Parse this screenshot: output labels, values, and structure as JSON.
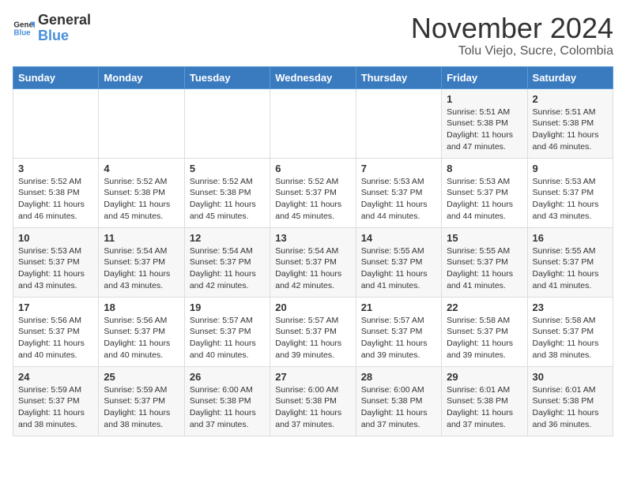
{
  "header": {
    "logo_general": "General",
    "logo_blue": "Blue",
    "month_year": "November 2024",
    "location": "Tolu Viejo, Sucre, Colombia"
  },
  "weekdays": [
    "Sunday",
    "Monday",
    "Tuesday",
    "Wednesday",
    "Thursday",
    "Friday",
    "Saturday"
  ],
  "weeks": [
    [
      {
        "day": "",
        "info": ""
      },
      {
        "day": "",
        "info": ""
      },
      {
        "day": "",
        "info": ""
      },
      {
        "day": "",
        "info": ""
      },
      {
        "day": "",
        "info": ""
      },
      {
        "day": "1",
        "info": "Sunrise: 5:51 AM\nSunset: 5:38 PM\nDaylight: 11 hours\nand 47 minutes."
      },
      {
        "day": "2",
        "info": "Sunrise: 5:51 AM\nSunset: 5:38 PM\nDaylight: 11 hours\nand 46 minutes."
      }
    ],
    [
      {
        "day": "3",
        "info": "Sunrise: 5:52 AM\nSunset: 5:38 PM\nDaylight: 11 hours\nand 46 minutes."
      },
      {
        "day": "4",
        "info": "Sunrise: 5:52 AM\nSunset: 5:38 PM\nDaylight: 11 hours\nand 45 minutes."
      },
      {
        "day": "5",
        "info": "Sunrise: 5:52 AM\nSunset: 5:38 PM\nDaylight: 11 hours\nand 45 minutes."
      },
      {
        "day": "6",
        "info": "Sunrise: 5:52 AM\nSunset: 5:37 PM\nDaylight: 11 hours\nand 45 minutes."
      },
      {
        "day": "7",
        "info": "Sunrise: 5:53 AM\nSunset: 5:37 PM\nDaylight: 11 hours\nand 44 minutes."
      },
      {
        "day": "8",
        "info": "Sunrise: 5:53 AM\nSunset: 5:37 PM\nDaylight: 11 hours\nand 44 minutes."
      },
      {
        "day": "9",
        "info": "Sunrise: 5:53 AM\nSunset: 5:37 PM\nDaylight: 11 hours\nand 43 minutes."
      }
    ],
    [
      {
        "day": "10",
        "info": "Sunrise: 5:53 AM\nSunset: 5:37 PM\nDaylight: 11 hours\nand 43 minutes."
      },
      {
        "day": "11",
        "info": "Sunrise: 5:54 AM\nSunset: 5:37 PM\nDaylight: 11 hours\nand 43 minutes."
      },
      {
        "day": "12",
        "info": "Sunrise: 5:54 AM\nSunset: 5:37 PM\nDaylight: 11 hours\nand 42 minutes."
      },
      {
        "day": "13",
        "info": "Sunrise: 5:54 AM\nSunset: 5:37 PM\nDaylight: 11 hours\nand 42 minutes."
      },
      {
        "day": "14",
        "info": "Sunrise: 5:55 AM\nSunset: 5:37 PM\nDaylight: 11 hours\nand 41 minutes."
      },
      {
        "day": "15",
        "info": "Sunrise: 5:55 AM\nSunset: 5:37 PM\nDaylight: 11 hours\nand 41 minutes."
      },
      {
        "day": "16",
        "info": "Sunrise: 5:55 AM\nSunset: 5:37 PM\nDaylight: 11 hours\nand 41 minutes."
      }
    ],
    [
      {
        "day": "17",
        "info": "Sunrise: 5:56 AM\nSunset: 5:37 PM\nDaylight: 11 hours\nand 40 minutes."
      },
      {
        "day": "18",
        "info": "Sunrise: 5:56 AM\nSunset: 5:37 PM\nDaylight: 11 hours\nand 40 minutes."
      },
      {
        "day": "19",
        "info": "Sunrise: 5:57 AM\nSunset: 5:37 PM\nDaylight: 11 hours\nand 40 minutes."
      },
      {
        "day": "20",
        "info": "Sunrise: 5:57 AM\nSunset: 5:37 PM\nDaylight: 11 hours\nand 39 minutes."
      },
      {
        "day": "21",
        "info": "Sunrise: 5:57 AM\nSunset: 5:37 PM\nDaylight: 11 hours\nand 39 minutes."
      },
      {
        "day": "22",
        "info": "Sunrise: 5:58 AM\nSunset: 5:37 PM\nDaylight: 11 hours\nand 39 minutes."
      },
      {
        "day": "23",
        "info": "Sunrise: 5:58 AM\nSunset: 5:37 PM\nDaylight: 11 hours\nand 38 minutes."
      }
    ],
    [
      {
        "day": "24",
        "info": "Sunrise: 5:59 AM\nSunset: 5:37 PM\nDaylight: 11 hours\nand 38 minutes."
      },
      {
        "day": "25",
        "info": "Sunrise: 5:59 AM\nSunset: 5:37 PM\nDaylight: 11 hours\nand 38 minutes."
      },
      {
        "day": "26",
        "info": "Sunrise: 6:00 AM\nSunset: 5:38 PM\nDaylight: 11 hours\nand 37 minutes."
      },
      {
        "day": "27",
        "info": "Sunrise: 6:00 AM\nSunset: 5:38 PM\nDaylight: 11 hours\nand 37 minutes."
      },
      {
        "day": "28",
        "info": "Sunrise: 6:00 AM\nSunset: 5:38 PM\nDaylight: 11 hours\nand 37 minutes."
      },
      {
        "day": "29",
        "info": "Sunrise: 6:01 AM\nSunset: 5:38 PM\nDaylight: 11 hours\nand 37 minutes."
      },
      {
        "day": "30",
        "info": "Sunrise: 6:01 AM\nSunset: 5:38 PM\nDaylight: 11 hours\nand 36 minutes."
      }
    ]
  ]
}
